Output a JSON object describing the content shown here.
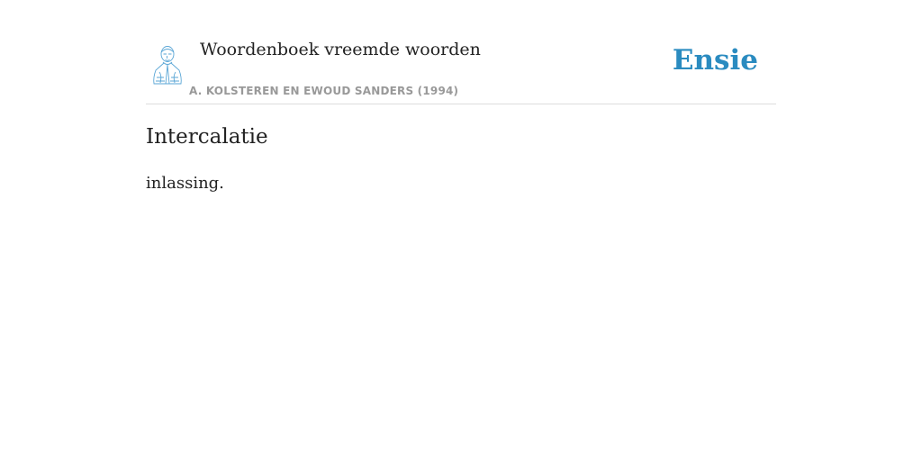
{
  "header": {
    "dictionary_title": "Woordenboek vreemde woorden",
    "authors": "A. KOLSTEREN EN EWOUD SANDERS (1994)",
    "avatar_icon": "author-portrait-icon",
    "brand": "Ensie",
    "brand_color": "#2a8bc0"
  },
  "entry": {
    "title": "Intercalatie",
    "definition": "inlassing."
  }
}
